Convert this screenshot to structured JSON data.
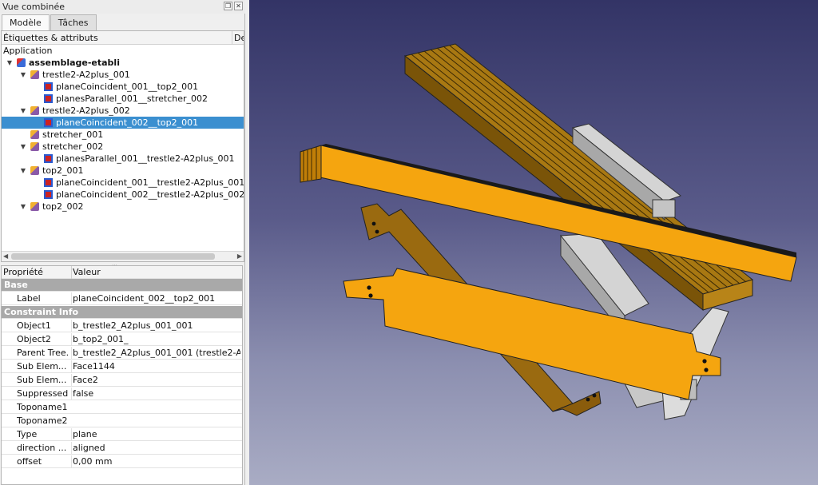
{
  "panel": {
    "title": "Vue combinée",
    "tabs": [
      {
        "label": "Modèle",
        "active": true
      },
      {
        "label": "Tâches",
        "active": false
      }
    ]
  },
  "tree": {
    "headers": [
      "Étiquettes & attributs",
      "De"
    ],
    "root_label": "Application",
    "items": [
      {
        "label": "assemblage-etabli",
        "icon": "assembly-icon",
        "depth": 0,
        "expanded": true,
        "bold": true
      },
      {
        "label": "trestle2-A2plus_001",
        "icon": "part-icon",
        "depth": 1,
        "expanded": true
      },
      {
        "label": "planeCoincident_001__top2_001",
        "icon": "constraint-icon",
        "depth": 2
      },
      {
        "label": "planesParallel_001__stretcher_002",
        "icon": "constraint-icon",
        "depth": 2
      },
      {
        "label": "trestle2-A2plus_002",
        "icon": "part-icon",
        "depth": 1,
        "expanded": true
      },
      {
        "label": "planeCoincident_002__top2_001",
        "icon": "constraint-icon",
        "depth": 2,
        "selected": true
      },
      {
        "label": "stretcher_001",
        "icon": "part-icon",
        "depth": 1
      },
      {
        "label": "stretcher_002",
        "icon": "part-icon",
        "depth": 1,
        "expanded": true
      },
      {
        "label": "planesParallel_001__trestle2-A2plus_001",
        "icon": "constraint-icon",
        "depth": 2
      },
      {
        "label": "top2_001",
        "icon": "part-icon",
        "depth": 1,
        "expanded": true
      },
      {
        "label": "planeCoincident_001__trestle2-A2plus_001",
        "icon": "constraint-icon",
        "depth": 2
      },
      {
        "label": "planeCoincident_002__trestle2-A2plus_002",
        "icon": "constraint-icon",
        "depth": 2
      },
      {
        "label": "top2_002",
        "icon": "part-icon",
        "depth": 1,
        "expanded": true
      }
    ]
  },
  "properties": {
    "headers": [
      "Propriété",
      "Valeur"
    ],
    "groups": [
      {
        "name": "Base",
        "rows": [
          {
            "name": "Label",
            "value": "planeCoincident_002__top2_001"
          }
        ]
      },
      {
        "name": "Constraint Info",
        "rows": [
          {
            "name": "Object1",
            "value": "b_trestle2_A2plus_001_001"
          },
          {
            "name": "Object2",
            "value": "b_top2_001_"
          },
          {
            "name": "Parent Tree...",
            "value": "b_trestle2_A2plus_001_001 (trestle2-A2..."
          },
          {
            "name": "Sub Elem...",
            "value": "Face1144"
          },
          {
            "name": "Sub Elem...",
            "value": "Face2"
          },
          {
            "name": "Suppressed",
            "value": "false"
          },
          {
            "name": "Toponame1",
            "value": ""
          },
          {
            "name": "Toponame2",
            "value": ""
          },
          {
            "name": "Type",
            "value": "plane"
          },
          {
            "name": "direction ...",
            "value": "aligned"
          },
          {
            "name": "offset",
            "value": "0,00 mm"
          }
        ]
      }
    ]
  },
  "colors": {
    "selection": "#3b8fd0",
    "wood_light": "#f5a50f",
    "wood_dark": "#9a6a10",
    "trestle_grey": "#d4d4d4"
  }
}
